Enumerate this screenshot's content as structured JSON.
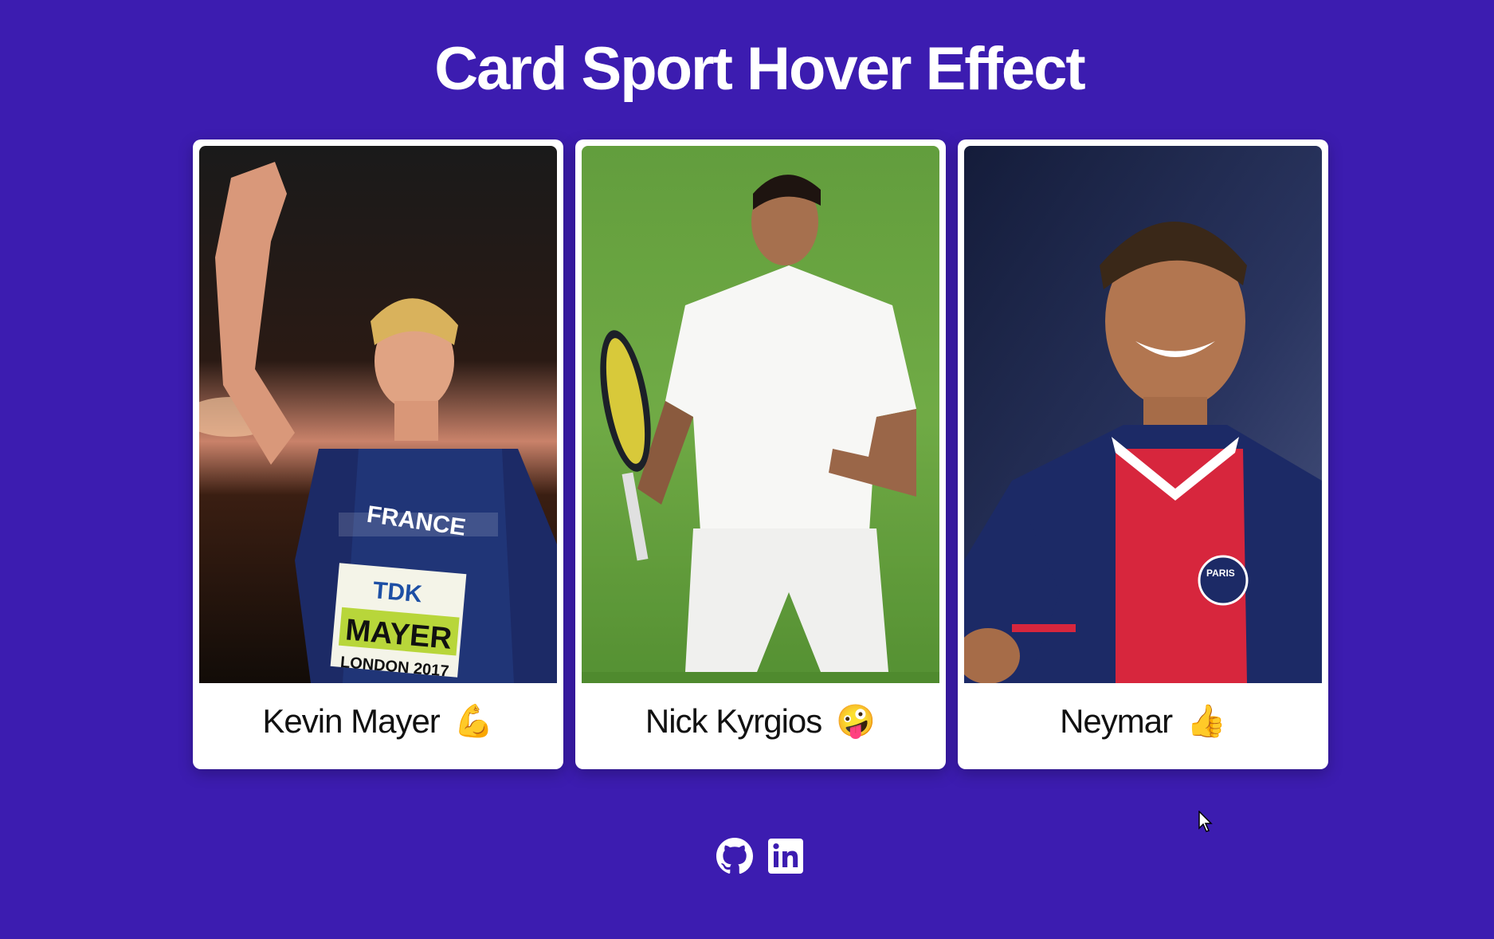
{
  "page": {
    "title": "Card Sport Hover Effect"
  },
  "cards": [
    {
      "name": "Kevin Mayer",
      "emoji": "💪",
      "jersey_text": "FRANCE",
      "bib_sponsor": "TDK",
      "bib_name": "MAYER",
      "bib_event": "LONDON 2017"
    },
    {
      "name": "Nick Kyrgios",
      "emoji": "🤪"
    },
    {
      "name": "Neymar",
      "emoji": "👍",
      "badge_text": "PARIS"
    }
  ],
  "socials": [
    {
      "icon": "github-icon"
    },
    {
      "icon": "linkedin-icon"
    }
  ],
  "colors": {
    "background": "#3c1cb0",
    "card": "#ffffff",
    "title": "#ffffff"
  }
}
